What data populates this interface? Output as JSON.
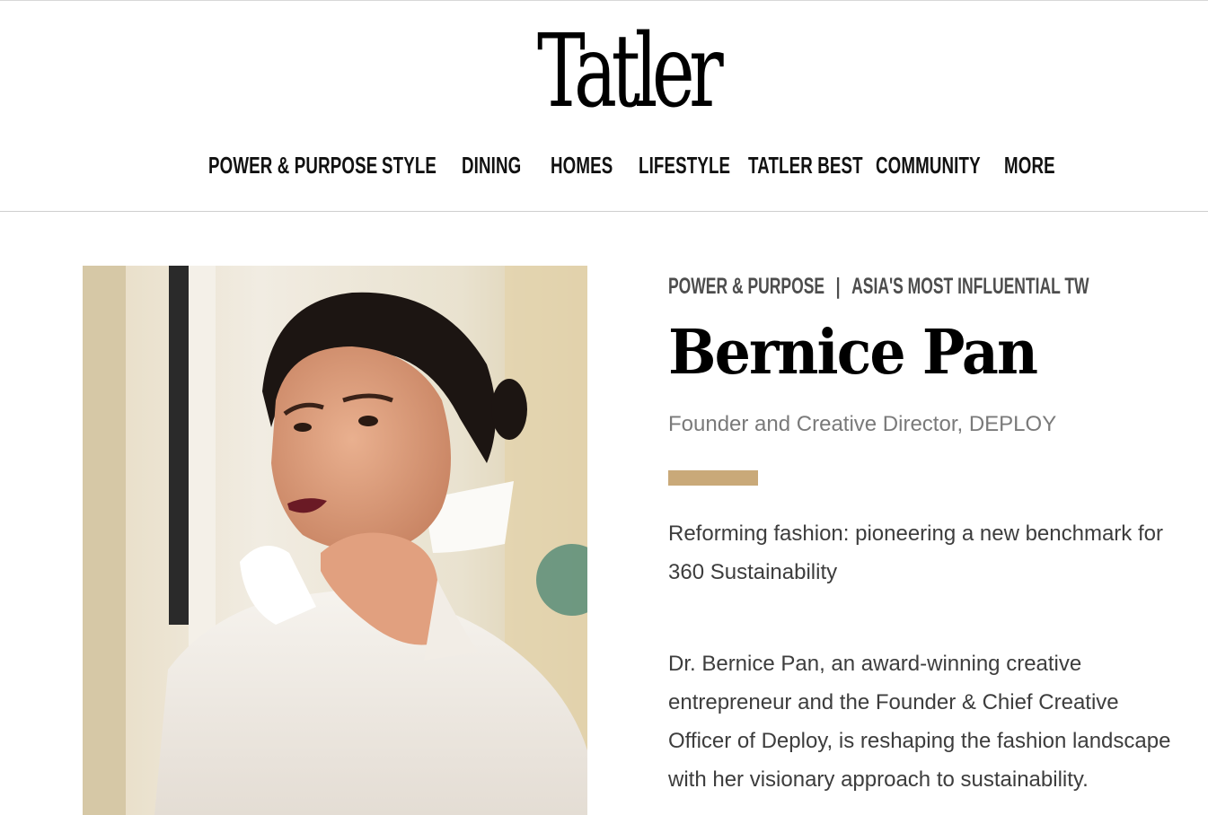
{
  "brand": {
    "logo_text": "Tatler"
  },
  "nav": {
    "items": [
      {
        "label": "POWER & PURPOSE"
      },
      {
        "label": "STYLE"
      },
      {
        "label": "DINING"
      },
      {
        "label": "HOMES"
      },
      {
        "label": "LIFESTYLE"
      },
      {
        "label": "TATLER BEST"
      },
      {
        "label": "COMMUNITY"
      },
      {
        "label": "MORE"
      }
    ]
  },
  "article": {
    "category": "POWER & PURPOSE",
    "separator": "|",
    "subcategory": "ASIA'S MOST INFLUENTIAL TW",
    "name": "Bernice Pan",
    "role": "Founder and Creative Director, DEPLOY",
    "accent_color": "#c9a979",
    "lede": "Reforming fashion: pioneering a new benchmark for 360 Sustainability",
    "body": "Dr. Bernice Pan, an award-winning creative entrepreneur and the Founder & Chief Creative Officer of Deploy, is reshaping the fashion landscape with her visionary approach to sustainability."
  }
}
